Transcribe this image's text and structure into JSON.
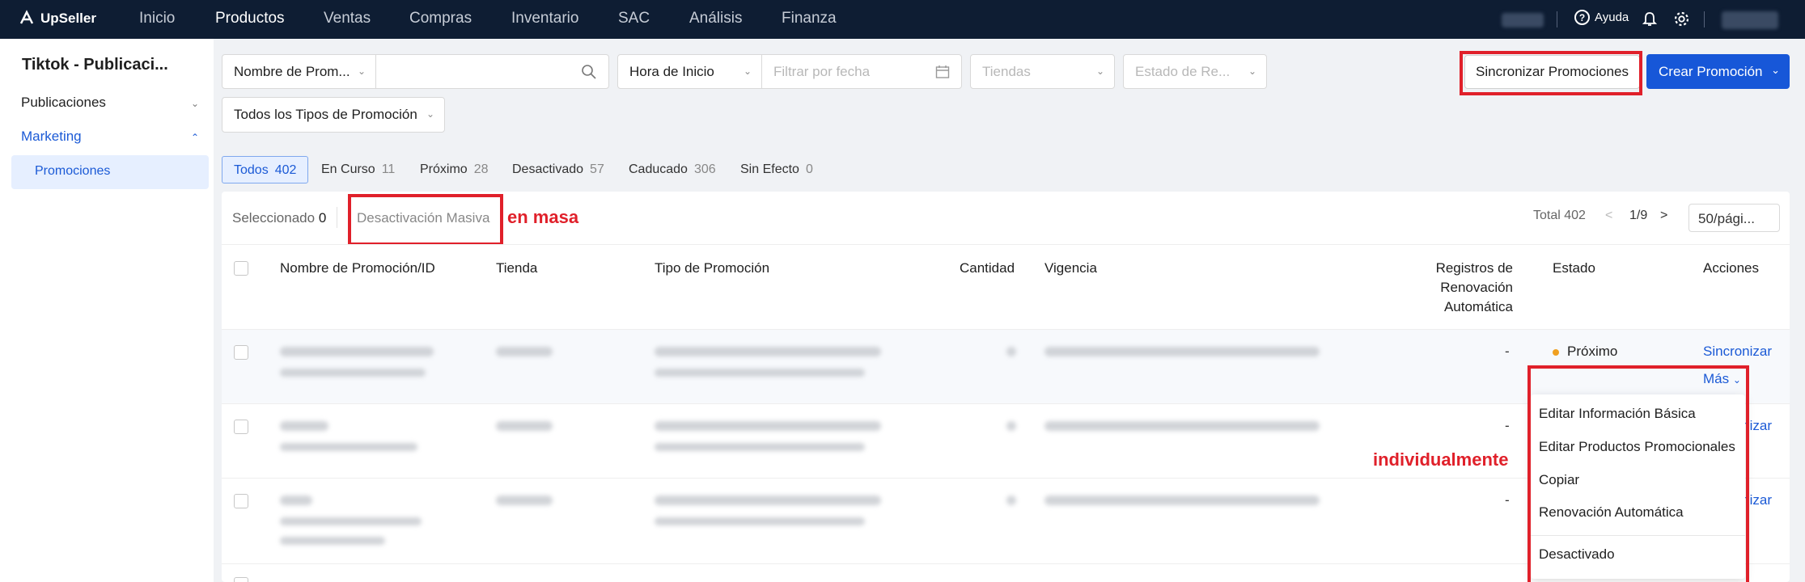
{
  "app": {
    "logo_text": "UpSeller",
    "nav": [
      "Inicio",
      "Productos",
      "Ventas",
      "Compras",
      "Inventario",
      "SAC",
      "Análisis",
      "Finanza"
    ],
    "active_nav": "Productos",
    "help_label": "Ayuda"
  },
  "sidebar": {
    "title": "Tiktok - Publicaci...",
    "items": [
      {
        "label": "Publicaciones"
      },
      {
        "label": "Marketing"
      }
    ],
    "sub_item": "Promociones"
  },
  "filters": {
    "search_type": "Nombre de Prom...",
    "search_value": "",
    "time_type": "Hora de Inicio",
    "date_placeholder": "Filtrar por fecha",
    "stores_placeholder": "Tiendas",
    "status_placeholder": "Estado de Re...",
    "promo_types": "Todos los Tipos de Promoción"
  },
  "actions": {
    "sync_label": "Sincronizar Promociones",
    "create_label": "Crear Promoción"
  },
  "tabs": [
    {
      "label": "Todos",
      "count": "402"
    },
    {
      "label": "En Curso",
      "count": "11"
    },
    {
      "label": "Próximo",
      "count": "28"
    },
    {
      "label": "Desactivado",
      "count": "57"
    },
    {
      "label": "Caducado",
      "count": "306"
    },
    {
      "label": "Sin Efecto",
      "count": "0"
    }
  ],
  "toolbar": {
    "selected_label": "Seleccionado",
    "selected_count": "0",
    "mass_label": "Desactivación Masiva",
    "total": "Total 402",
    "page": "1/9",
    "page_size": "50/pági..."
  },
  "annotations": {
    "mass": "en masa",
    "individual": "individualmente",
    "color": "#e0202a"
  },
  "table": {
    "columns": [
      "Nombre de Promoción/ID",
      "Tienda",
      "Tipo de Promoción",
      "Cantidad",
      "Vigencia",
      "Registros de",
      "Renovación",
      "Automática",
      "Estado",
      "Acciones"
    ],
    "rows": [
      {
        "registros": "-",
        "estado": "Próximo",
        "action": "Sincronizar",
        "more": "Más"
      },
      {
        "registros": "-",
        "action": "Sincronizar"
      },
      {
        "registros": "-",
        "action": "Sincronizar"
      }
    ]
  },
  "more_menu": [
    "Editar Información Básica",
    "Editar Productos Promocionales",
    "Copiar",
    "Renovación Automática",
    "Desactivado"
  ]
}
